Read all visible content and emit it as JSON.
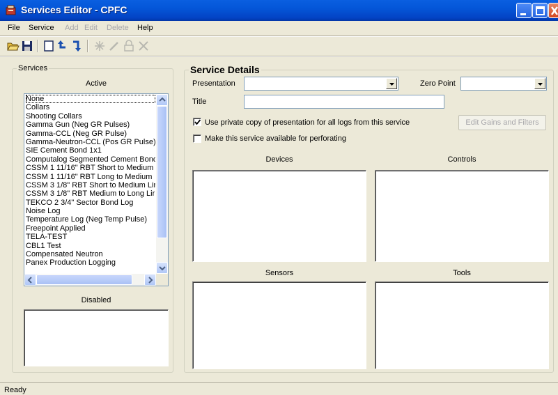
{
  "window": {
    "title": "Services Editor - CPFC",
    "icon": "services-editor-app-icon",
    "colors": {
      "titlebar": "#0456d8",
      "close": "#d3461f",
      "face": "#ece9d8"
    }
  },
  "menu": {
    "file": "File",
    "service": "Service",
    "add": "Add",
    "edit": "Edit",
    "delete": "Delete",
    "help": "Help"
  },
  "toolbar": {
    "icons": [
      "open-folder-icon",
      "save-icon",
      "new-document-icon",
      "undo-icon",
      "redo-icon",
      "add-icon",
      "edit-icon",
      "lock-icon",
      "tools-icon"
    ]
  },
  "services": {
    "group_label": "Services",
    "active_label": "Active",
    "disabled_label": "Disabled",
    "active_items": [
      "None",
      "Collars",
      "Shooting Collars",
      "Gamma Gun (Neg GR Pulses)",
      "Gamma-CCL (Neg GR Pulse)",
      "Gamma-Neutron-CCL (Pos GR Pulse)",
      "SIE Cement Bond 1x1",
      "Computalog Segmented Cement Bond",
      "CSSM 1 11/16\" RBT Short to Medium",
      "CSSM 1 11/16\" RBT Long to Medium",
      "CSSM 3 1/8\" RBT Short to Medium Lir",
      "CSSM 3 1/8\" RBT Medium to Long Lir",
      "TEKCO 2 3/4\" Sector Bond Log",
      "Noise Log",
      "Temperature Log (Neg Temp Pulse)",
      "Freepoint Applied",
      "TELA-TEST",
      "CBL1 Test",
      "Compensated Neutron",
      "Panex Production Logging"
    ],
    "selected_item": "None"
  },
  "details": {
    "heading": "Service Details",
    "presentation_label": "Presentation",
    "presentation_value": "",
    "zero_point_label": "Zero Point",
    "zero_point_value": "",
    "title_label": "Title",
    "title_value": "",
    "private_copy_label": "Use private copy of presentation for all logs from this service",
    "private_copy_checked": true,
    "perforating_label": "Make this service available for perforating",
    "perforating_checked": false,
    "edit_gains_button": "Edit Gains and Filters",
    "devices_label": "Devices",
    "controls_label": "Controls",
    "sensors_label": "Sensors",
    "tools_label": "Tools"
  },
  "status": {
    "text": "Ready"
  }
}
